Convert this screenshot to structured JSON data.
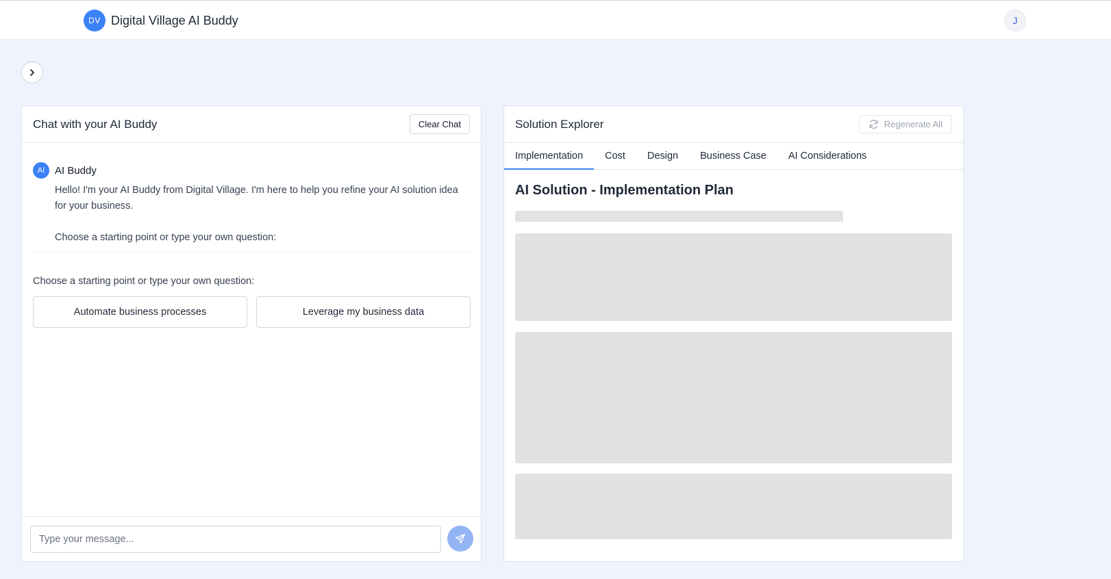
{
  "header": {
    "logo_text": "DV",
    "title": "Digital Village AI Buddy",
    "user_initial": "J"
  },
  "chat": {
    "title": "Chat with your AI Buddy",
    "clear_label": "Clear Chat",
    "message": {
      "avatar": "AI",
      "sender": "AI Buddy",
      "text_1": "Hello! I'm your AI Buddy from Digital Village. I'm here to help you refine your AI solution idea for your business.",
      "text_2": "Choose a starting point or type your own question:"
    },
    "starter_label": "Choose a starting point or type your own question:",
    "starters": [
      "Automate business processes",
      "Leverage my business data"
    ],
    "input_placeholder": "Type your message..."
  },
  "explorer": {
    "title": "Solution Explorer",
    "regenerate_label": "Regenerate All",
    "tabs": [
      "Implementation",
      "Cost",
      "Design",
      "Business Case",
      "AI Considerations"
    ],
    "active_tab": "Implementation",
    "content_title": "AI Solution - Implementation Plan"
  },
  "colors": {
    "accent": "#3b82f6",
    "background": "#eef3fd",
    "skeleton": "#e2e2e2"
  },
  "icons": {
    "sidebar_toggle": "chevron-right-icon",
    "regenerate": "refresh-icon",
    "send": "send-icon"
  }
}
